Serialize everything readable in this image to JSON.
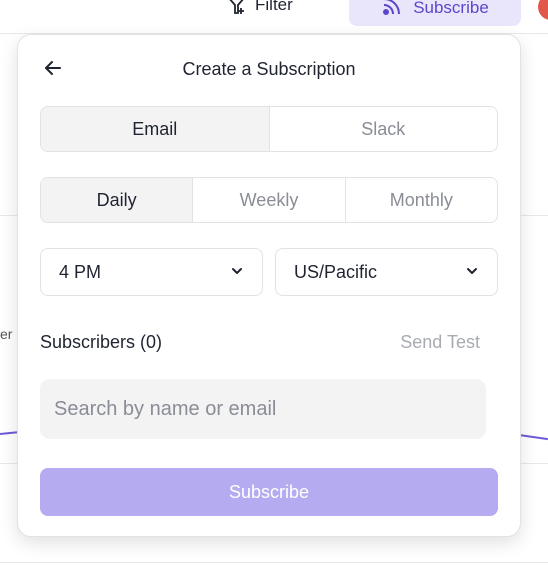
{
  "background": {
    "filter_label": "Filter",
    "subscribe_label": "Subscribe",
    "side_text": "er"
  },
  "popover": {
    "title": "Create a Subscription",
    "channel_tabs": [
      {
        "label": "Email",
        "active": true
      },
      {
        "label": "Slack",
        "active": false
      }
    ],
    "frequency_tabs": [
      {
        "label": "Daily",
        "active": true
      },
      {
        "label": "Weekly",
        "active": false
      },
      {
        "label": "Monthly",
        "active": false
      }
    ],
    "time_select": {
      "value": "4 PM"
    },
    "timezone_select": {
      "value": "US/Pacific"
    },
    "subscribers_label": "Subscribers (0)",
    "send_test_label": "Send Test",
    "search": {
      "placeholder": "Search by name or email",
      "value": ""
    },
    "submit_label": "Subscribe"
  },
  "colors": {
    "accent": "#6e5bd9",
    "submit_disabled": "#b4abf0",
    "subscribe_bg": "#e9e6fb"
  }
}
